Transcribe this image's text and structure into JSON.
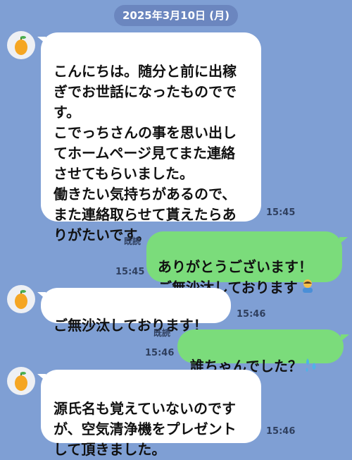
{
  "date_label": "2025年3月10日 (月)",
  "messages": [
    {
      "sender": "them",
      "text": "こんにちは。随分と前に出稼\nぎでお世話になったものでs\nす。\nこでっちさんの事を思い出し\nてホームページ見てまた連絡\nさせてもらいました。\n働きたい気持ちがあるので、\nまた連絡取らせて貰えたらあ\nりがたいです。",
      "time": "15:45"
    },
    {
      "sender": "me",
      "text": "ありがとうございます！\nご無沙汰しております",
      "emoji_icon": "bowing-person-icon",
      "read_label": "既読",
      "time": "15:45"
    },
    {
      "sender": "them",
      "text": "ご無沙汰しております！",
      "time": "15:46"
    },
    {
      "sender": "me",
      "text": "誰ちゃんでした？",
      "emoji_icon": "sweat-droplets-icon",
      "read_label": "既読",
      "time": "15:46"
    },
    {
      "sender": "them",
      "text": "源氏名も覚えていないのです\nが、空気清浄機をプレゼント\nして頂きました。",
      "time": "15:46"
    }
  ],
  "colors": {
    "background": "#7f9fd4",
    "outgoing_bubble": "#7bdc7b",
    "incoming_bubble": "#ffffff"
  },
  "avatar_icon": "orange-fruit-icon"
}
